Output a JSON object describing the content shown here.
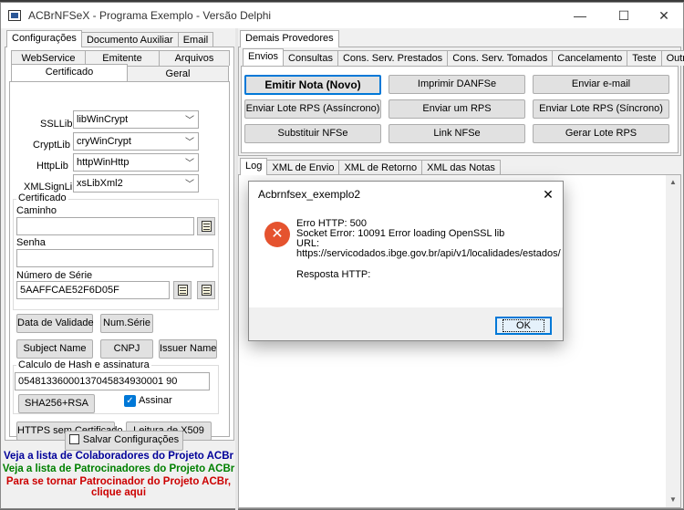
{
  "window": {
    "title": "ACBrNFSeX - Programa Exemplo - Versão Delphi",
    "minimize": "—",
    "maximize": "☐",
    "close": "✕"
  },
  "left": {
    "top_tabs": [
      "Configurações",
      "Documento Auxiliar",
      "Email"
    ],
    "sub_tabs_row1": [
      "WebService",
      "Emitente",
      "Arquivos"
    ],
    "sub_tabs_row2": [
      "Certificado",
      "Geral"
    ],
    "ssl_label": "SSLLib",
    "ssl_value": "libWinCrypt",
    "crypt_label": "CryptLib",
    "crypt_value": "cryWinCrypt",
    "http_label": "HttpLib",
    "http_value": "httpWinHttp",
    "xmlsign_label": "XMLSignLib",
    "xmlsign_value": "xsLibXml2",
    "cert_group": "Certificado",
    "caminho_label": "Caminho",
    "caminho_value": "",
    "senha_label": "Senha",
    "senha_value": "",
    "serie_label": "Número de Série",
    "serie_value": "5AAFFCAE52F6D05F",
    "btn_validade": "Data de Validade",
    "btn_num_serie": "Num.Série",
    "btn_subject": "Subject Name",
    "btn_cnpj": "CNPJ",
    "btn_issuer": "Issuer Name",
    "hash_group": "Calculo de Hash e assinatura",
    "hash_value": "05481336000137045834930001 90",
    "btn_sha": "SHA256+RSA",
    "assinar_label": "Assinar",
    "btn_https": "HTTPS sem Certificado",
    "btn_x509": "Leitura de X509",
    "btn_salvar": "Salvar Configurações",
    "link1": "Veja a lista de Colaboradores do Projeto ACBr",
    "link2": "Veja a lista de Patrocinadores do Projeto ACBr",
    "link3a": "Para se tornar Patrocinador do Projeto ACBr,",
    "link3b": "clique aqui",
    "colors": {
      "link1": "#000099",
      "link2": "#008000",
      "link3": "#cc0000"
    }
  },
  "right": {
    "outer_tab": "Demais Provedores",
    "tabs": [
      "Envios",
      "Consultas",
      "Cons. Serv. Prestados",
      "Cons. Serv. Tomados",
      "Cancelamento",
      "Teste",
      "Outros"
    ],
    "btn_emitir": "Emitir Nota (Novo)",
    "btn_imprimir": "Imprimir DANFSe",
    "btn_email": "Enviar e-mail",
    "btn_lote_assinc": "Enviar Lote RPS (Assíncrono)",
    "btn_enviar_um": "Enviar um RPS",
    "btn_lote_sinc": "Enviar Lote RPS (Síncrono)",
    "btn_substituir": "Substituir NFSe",
    "btn_link": "Link NFSe",
    "btn_gerar": "Gerar Lote RPS",
    "log_tabs": [
      "Log",
      "XML de Envio",
      "XML de Retorno",
      "XML das Notas"
    ]
  },
  "dialog": {
    "title": "Acbrnfsex_exemplo2",
    "close": "✕",
    "icon": "error-icon",
    "line1": "Erro HTTP: 500",
    "line2": "Socket Error: 10091 Error loading OpenSSL lib",
    "line3": "URL:",
    "line4": "https://servicodados.ibge.gov.br/api/v1/localidades/estados/",
    "line5": "Resposta HTTP:",
    "ok": "OK"
  }
}
